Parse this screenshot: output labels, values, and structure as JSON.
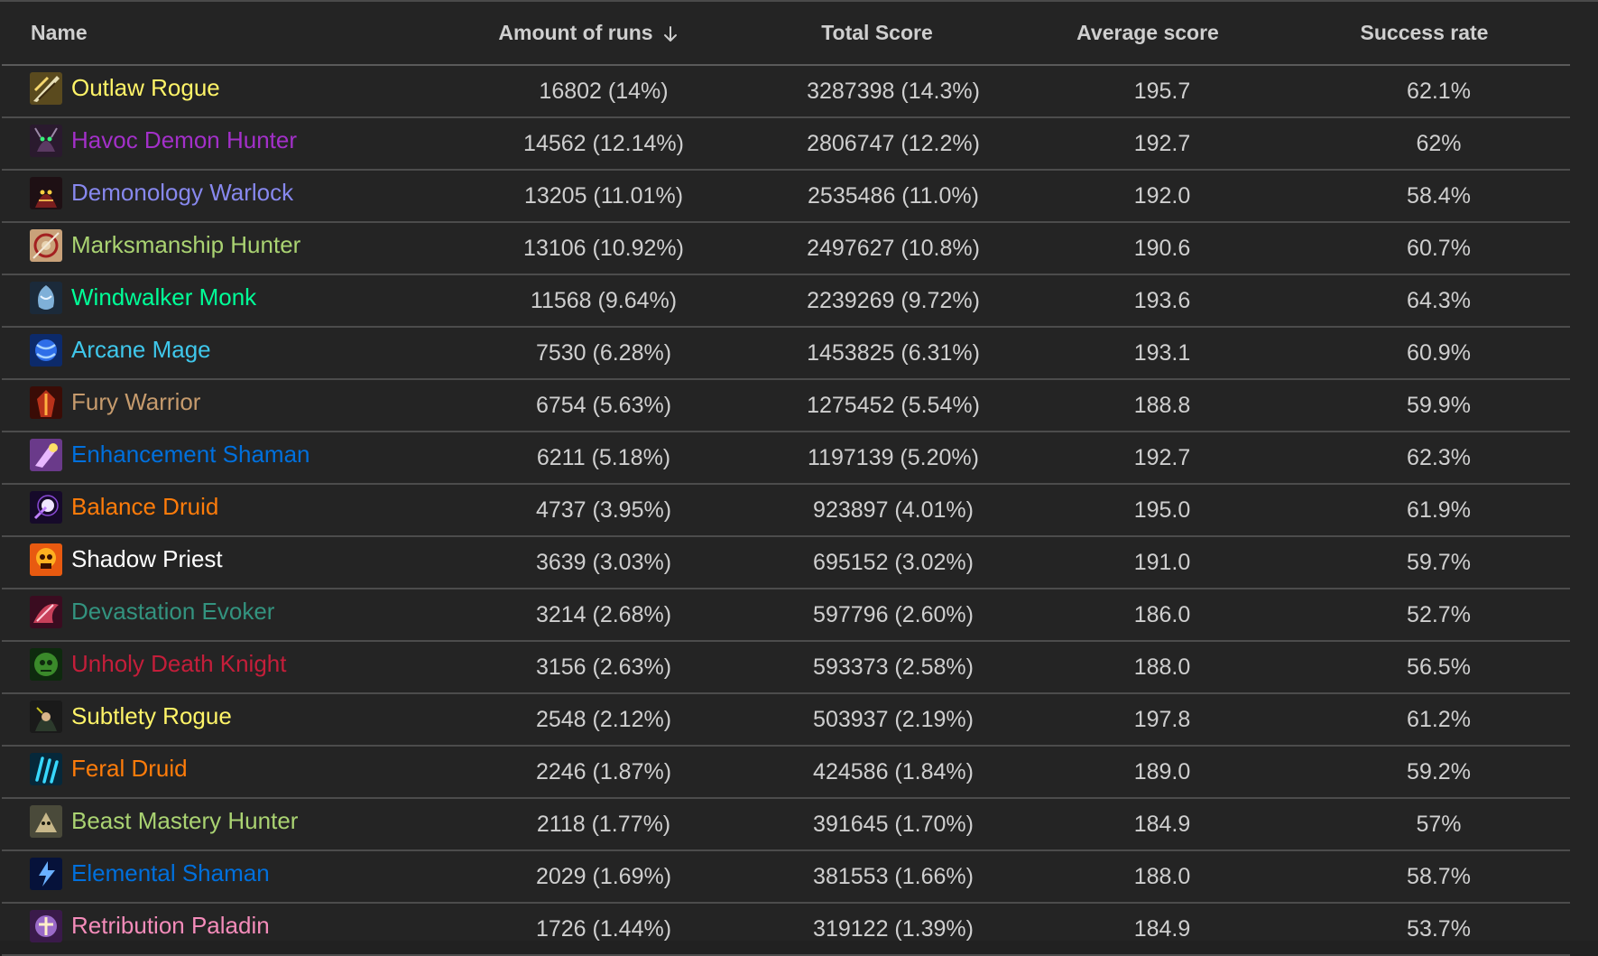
{
  "table": {
    "columns": {
      "name": "Name",
      "runs": "Amount of runs",
      "total": "Total Score",
      "avg": "Average score",
      "rate": "Success rate"
    },
    "sort": {
      "column": "runs",
      "direction": "desc",
      "icon": "arrow-down-icon"
    },
    "rows": [
      {
        "name": "Outlaw Rogue",
        "color": "#fff468",
        "icon": "outlaw-rogue-icon",
        "runs": "16802 (14%)",
        "total": "3287398 (14.3%)",
        "avg": "195.7",
        "rate": "62.1%"
      },
      {
        "name": "Havoc Demon Hunter",
        "color": "#a330c9",
        "icon": "havoc-demon-hunter-icon",
        "runs": "14562 (12.14%)",
        "total": "2806747 (12.2%)",
        "avg": "192.7",
        "rate": "62%"
      },
      {
        "name": "Demonology Warlock",
        "color": "#8788ee",
        "icon": "demonology-warlock-icon",
        "runs": "13205 (11.01%)",
        "total": "2535486 (11.0%)",
        "avg": "192.0",
        "rate": "58.4%"
      },
      {
        "name": "Marksmanship Hunter",
        "color": "#aad372",
        "icon": "marksmanship-hunter-icon",
        "runs": "13106 (10.92%)",
        "total": "2497627 (10.8%)",
        "avg": "190.6",
        "rate": "60.7%"
      },
      {
        "name": "Windwalker Monk",
        "color": "#00ff98",
        "icon": "windwalker-monk-icon",
        "runs": "11568 (9.64%)",
        "total": "2239269 (9.72%)",
        "avg": "193.6",
        "rate": "64.3%"
      },
      {
        "name": "Arcane Mage",
        "color": "#3fc7eb",
        "icon": "arcane-mage-icon",
        "runs": "7530 (6.28%)",
        "total": "1453825 (6.31%)",
        "avg": "193.1",
        "rate": "60.9%"
      },
      {
        "name": "Fury Warrior",
        "color": "#c69b6d",
        "icon": "fury-warrior-icon",
        "runs": "6754 (5.63%)",
        "total": "1275452 (5.54%)",
        "avg": "188.8",
        "rate": "59.9%"
      },
      {
        "name": "Enhancement Shaman",
        "color": "#0070dd",
        "icon": "enhancement-shaman-icon",
        "runs": "6211 (5.18%)",
        "total": "1197139 (5.20%)",
        "avg": "192.7",
        "rate": "62.3%"
      },
      {
        "name": "Balance Druid",
        "color": "#ff7c0a",
        "icon": "balance-druid-icon",
        "runs": "4737 (3.95%)",
        "total": "923897 (4.01%)",
        "avg": "195.0",
        "rate": "61.9%"
      },
      {
        "name": "Shadow Priest",
        "color": "#ffffff",
        "icon": "shadow-priest-icon",
        "runs": "3639 (3.03%)",
        "total": "695152 (3.02%)",
        "avg": "191.0",
        "rate": "59.7%"
      },
      {
        "name": "Devastation Evoker",
        "color": "#33937f",
        "icon": "devastation-evoker-icon",
        "runs": "3214 (2.68%)",
        "total": "597796 (2.60%)",
        "avg": "186.0",
        "rate": "52.7%"
      },
      {
        "name": "Unholy Death Knight",
        "color": "#c41e3a",
        "icon": "unholy-death-knight-icon",
        "runs": "3156 (2.63%)",
        "total": "593373 (2.58%)",
        "avg": "188.0",
        "rate": "56.5%"
      },
      {
        "name": "Subtlety Rogue",
        "color": "#fff468",
        "icon": "subtlety-rogue-icon",
        "runs": "2548 (2.12%)",
        "total": "503937 (2.19%)",
        "avg": "197.8",
        "rate": "61.2%"
      },
      {
        "name": "Feral Druid",
        "color": "#ff7c0a",
        "icon": "feral-druid-icon",
        "runs": "2246 (1.87%)",
        "total": "424586 (1.84%)",
        "avg": "189.0",
        "rate": "59.2%"
      },
      {
        "name": "Beast Mastery Hunter",
        "color": "#aad372",
        "icon": "beast-mastery-hunter-icon",
        "runs": "2118 (1.77%)",
        "total": "391645 (1.70%)",
        "avg": "184.9",
        "rate": "57%"
      },
      {
        "name": "Elemental Shaman",
        "color": "#0070dd",
        "icon": "elemental-shaman-icon",
        "runs": "2029 (1.69%)",
        "total": "381553 (1.66%)",
        "avg": "188.0",
        "rate": "58.7%"
      },
      {
        "name": "Retribution Paladin",
        "color": "#f48cba",
        "icon": "retribution-paladin-icon",
        "runs": "1726 (1.44%)",
        "total": "319122 (1.39%)",
        "avg": "184.9",
        "rate": "53.7%"
      }
    ]
  }
}
